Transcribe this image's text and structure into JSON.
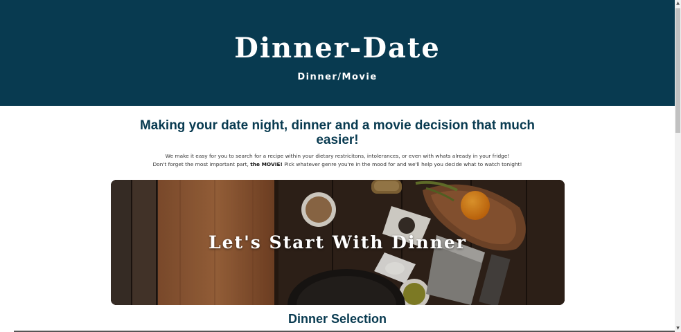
{
  "header": {
    "title": "Dinner-Date",
    "subtitle": "Dinner/Movie"
  },
  "intro": {
    "heading": "Making your date night, dinner and a movie decision that much easier!",
    "line1": "We make it easy for you to search for a recipe within your dietary restricitons, intolerances, or even with whats already in your fridge!",
    "line2_prefix": "Don't forget the most important part, ",
    "line2_bold": "the MOVIE!",
    "line2_suffix": " Pick whatever genre you're in the mood for and we'll help you decide what to watch tonight!"
  },
  "banner": {
    "title": "Let's Start With Dinner"
  },
  "dinner_section": {
    "heading": "Dinner Selection"
  },
  "colors": {
    "header_bg": "#083a50",
    "heading_text": "#083a50"
  }
}
